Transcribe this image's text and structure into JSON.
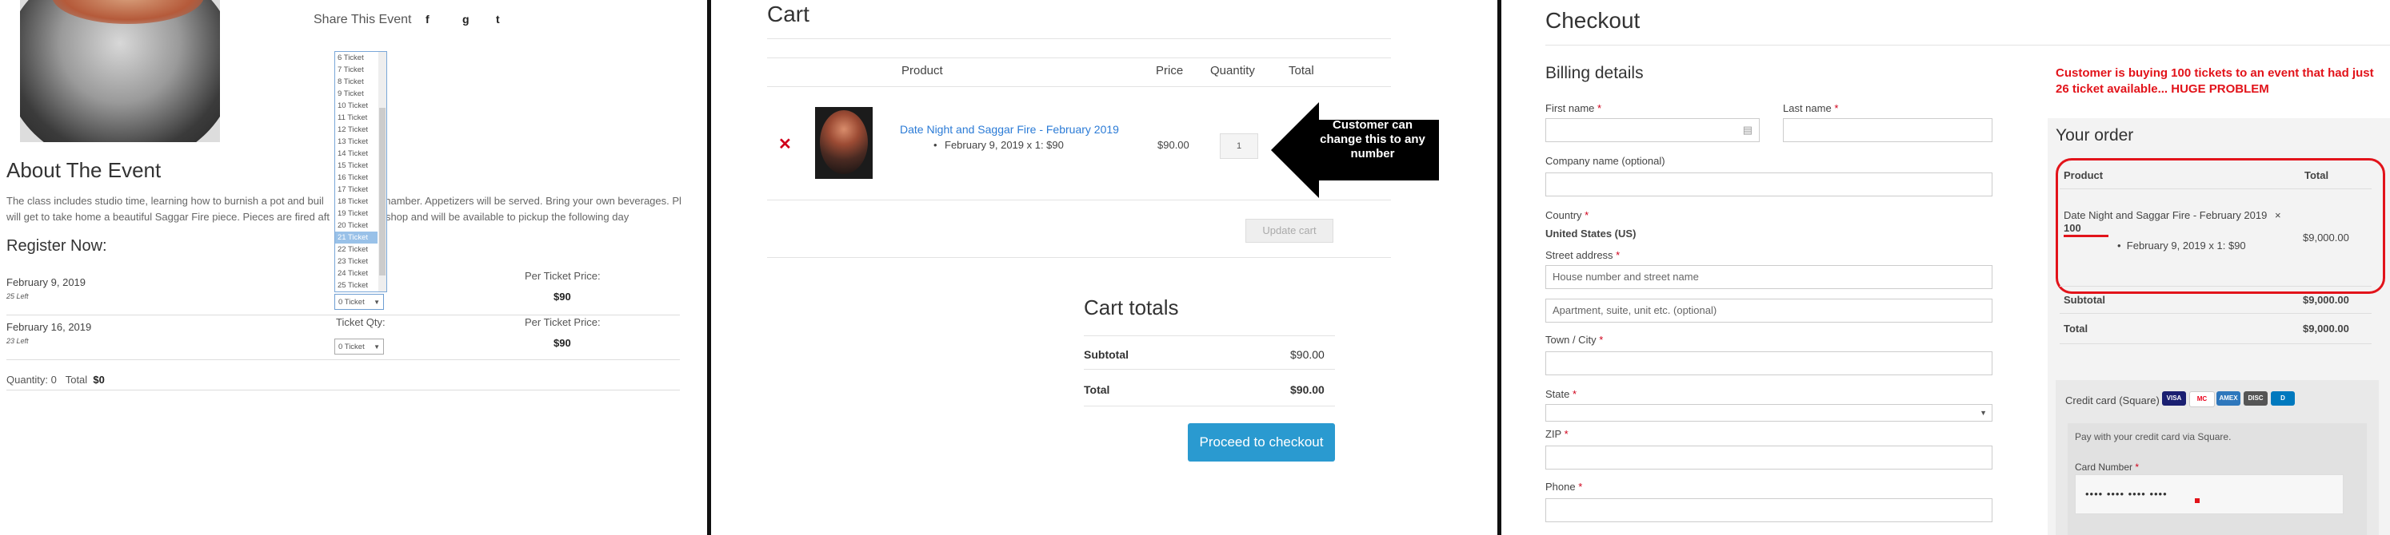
{
  "event_page": {
    "share_label": "Share This Event",
    "share_icons": [
      "facebook-icon",
      "google-icon",
      "twitter-icon"
    ],
    "share_glyphs": [
      "f",
      "g",
      "t"
    ],
    "dropdown_options": [
      "6 Ticket",
      "7 Ticket",
      "8 Ticket",
      "9 Ticket",
      "10 Ticket",
      "11 Ticket",
      "12 Ticket",
      "13 Ticket",
      "14 Ticket",
      "15 Ticket",
      "16 Ticket",
      "17 Ticket",
      "18 Ticket",
      "19 Ticket",
      "20 Ticket",
      "21 Ticket",
      "22 Ticket",
      "23 Ticket",
      "24 Ticket",
      "25 Ticket"
    ],
    "dropdown_selected": "21 Ticket",
    "about_title": "About The Event",
    "description_line1": "The class includes studio time, learning how to burnish a pot and buil",
    "description_line1_end": "chamber.  Appetizers will be served. Bring your own beverages.  Pl",
    "description_line2": "will get to take home a beautiful Saggar Fire piece.  Pieces are fired aft",
    "description_line2_end": "shop and will be available to pickup the following day",
    "register_title": "Register Now:",
    "rows": [
      {
        "date": "February 9, 2019",
        "left": "25 Left",
        "qty_value": "0 Ticket",
        "price_label": "Per Ticket Price:",
        "price": "$90"
      },
      {
        "date": "February 16, 2019",
        "left": "23 Left",
        "qty_label": "Ticket Qty:",
        "qty_value": "0 Ticket",
        "price_label": "Per Ticket Price:",
        "price": "$90"
      }
    ],
    "quantity_label": "Quantity: 0",
    "total_label": "Total",
    "total_value": "$0"
  },
  "cart_page": {
    "title": "Cart",
    "headers": {
      "product": "Product",
      "price": "Price",
      "quantity": "Quantity",
      "total": "Total"
    },
    "remove_glyph": "✕",
    "item": {
      "name": "Date Night and Saggar Fire - February 2019",
      "meta": "February 9, 2019 x 1: $90",
      "price": "$90.00",
      "quantity": "1"
    },
    "update_button": "Update cart",
    "callout_text": "Customer can change this to any number",
    "totals_title": "Cart totals",
    "subtotal_label": "Subtotal",
    "subtotal_value": "$90.00",
    "total_label": "Total",
    "total_value": "$90.00",
    "proceed_button": "Proceed to checkout"
  },
  "checkout_page": {
    "title": "Checkout",
    "billing_title": "Billing details",
    "required_mark": "*",
    "fields": {
      "first_name": "First name",
      "last_name": "Last name",
      "company": "Company name (optional)",
      "country": "Country",
      "country_value": "United States (US)",
      "street": "Street address",
      "street_placeholder": "House number and street name",
      "apt_placeholder": "Apartment, suite, unit etc. (optional)",
      "city": "Town / City",
      "state": "State",
      "zip": "ZIP",
      "phone": "Phone"
    },
    "warning": "Customer is buying 100 tickets to an event that had just 26 ticket available... HUGE PROBLEM",
    "order_title": "Your order",
    "order_headers": {
      "product": "Product",
      "total": "Total"
    },
    "order_item": {
      "name": "Date Night and Saggar Fire - February 2019",
      "times": "×",
      "qty": "100",
      "meta": "February 9, 2019 x 1: $90",
      "total": "$9,000.00"
    },
    "subtotal_label": "Subtotal",
    "subtotal_value": "$9,000.00",
    "total_label": "Total",
    "total_value": "$9,000.00",
    "payment_label": "Credit card (Square)",
    "payment_note": "Pay with your credit card via Square.",
    "card_number_label": "Card Number",
    "card_number_placeholder": "•••• •••• •••• ••••",
    "card_brands": [
      "VISA",
      "MC",
      "AMEX",
      "DISC",
      "D"
    ],
    "colors": {
      "warning_red": "#e2131a",
      "link_blue": "#2b7bd6",
      "button_blue": "#2a9ad0"
    }
  }
}
